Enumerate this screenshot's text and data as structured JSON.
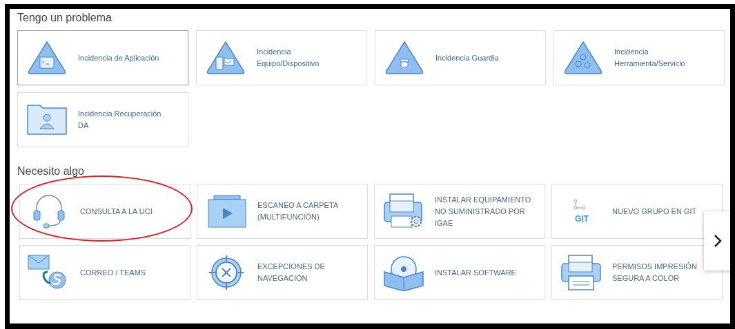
{
  "sections": [
    {
      "title": "Tengo un problema",
      "items": [
        {
          "label": "Incidencia de Aplicación",
          "kind": "terminal",
          "selected": true
        },
        {
          "label": "Incidencia\nEquipo/Dispositivo",
          "kind": "devices",
          "selected": false
        },
        {
          "label": "Incidencia Guardia",
          "kind": "guard",
          "selected": false
        },
        {
          "label": "Incidencia\nHerramienta/Servicio",
          "kind": "gears",
          "selected": false
        },
        {
          "label": "Incidencia Recuperación\nDA",
          "kind": "folder",
          "selected": false
        }
      ]
    },
    {
      "title": "Necesito algo",
      "next": true,
      "items": [
        {
          "label": "CONSULTA A LA UCI",
          "kind": "headset",
          "circled": true
        },
        {
          "label": "ESCANEO A CARPETA\n(MULTIFUNCIÓN)",
          "kind": "scan",
          "circled": false
        },
        {
          "label": "INSTALAR EQUIPAMIENTO\nNO SUMINISTRADO POR\nIGAE",
          "kind": "printergear",
          "circled": false
        },
        {
          "label": "NUEVO GRUPO EN GIT",
          "kind": "git",
          "icon_text": "GIT",
          "circled": false
        },
        {
          "label": "CORREO / TEAMS",
          "kind": "mail",
          "circled": false
        },
        {
          "label": "EXCEPCIONES DE\nNAVEGACIÓN",
          "kind": "target",
          "circled": false
        },
        {
          "label": "INSTALAR SOFTWARE",
          "kind": "disc",
          "circled": false
        },
        {
          "label": "PERMISOS IMPRESIÓN\nSEGURA A COLOR",
          "kind": "printer",
          "circled": false
        }
      ]
    }
  ]
}
